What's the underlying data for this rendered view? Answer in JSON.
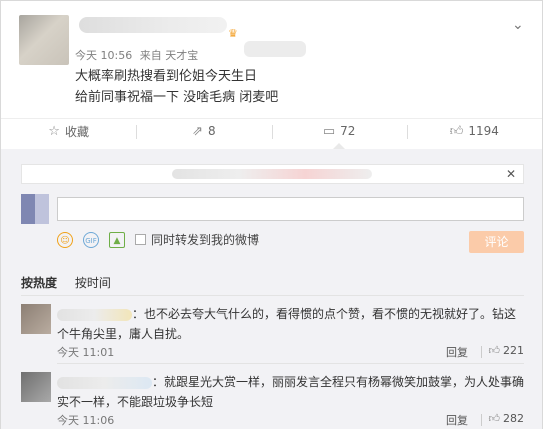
{
  "post": {
    "meta_time": "今天 10:56",
    "meta_source": "来自 天才宝",
    "lines": [
      "大概率刷热搜看到伦姐今天生日",
      "给前同事祝福一下 没啥毛病 闭麦吧"
    ]
  },
  "actions": {
    "favorite": "收藏",
    "repost": "8",
    "comment": "72",
    "like": "1194"
  },
  "composer": {
    "repost_checkbox": "同时转发到我的微博",
    "submit": "评论"
  },
  "sort": {
    "hot": "按热度",
    "time": "按时间"
  },
  "comments": [
    {
      "text": "：也不必去夸大气什么的，看得惯的点个赞，看不惯的无视就好了。钻这个牛角尖里，庸人自扰。",
      "time": "今天 11:01",
      "reply": "回复",
      "likes": "221"
    },
    {
      "text": "：就跟星光大赏一样，丽丽发言全程只有杨幂微笑加鼓掌，为人处事确实不一样，不能跟垃圾争长短",
      "time": "今天 11:06",
      "reply": "回复",
      "likes": "282"
    }
  ],
  "icons": {
    "collapse": "chevron-down-icon",
    "favorite": "star-icon",
    "repost": "repost-icon",
    "comment": "comment-icon",
    "like": "thumbs-up-icon",
    "close": "close-icon"
  },
  "colors": {
    "submit_bg": "#fbcba9",
    "vip": "#f3a22c",
    "panel_bg": "#f2f2f5"
  }
}
